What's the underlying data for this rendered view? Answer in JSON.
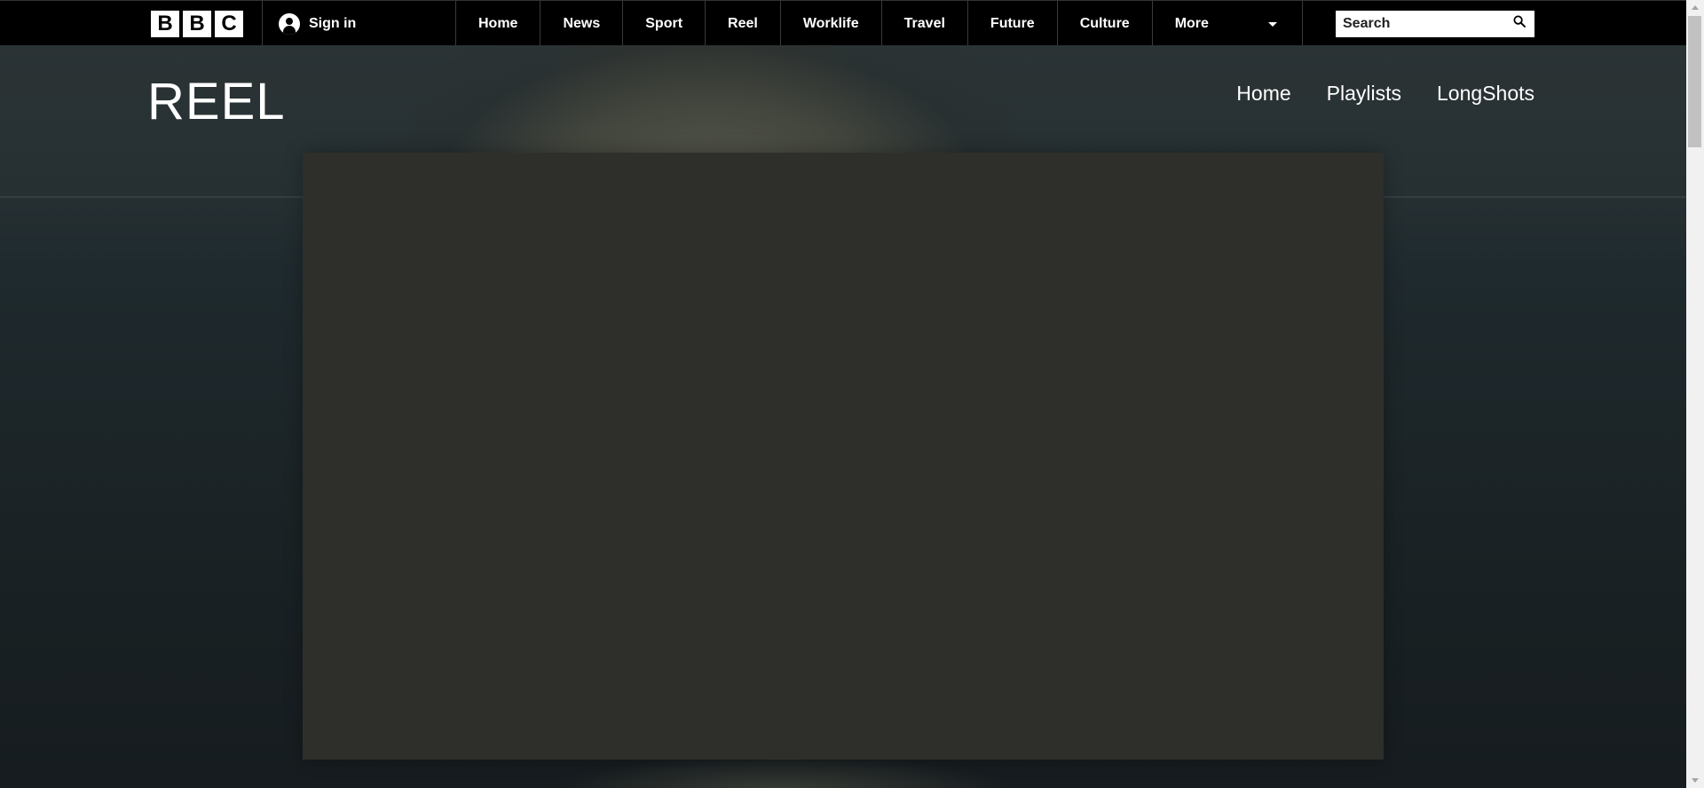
{
  "header": {
    "logo_letters": [
      "B",
      "B",
      "C"
    ],
    "signin_label": "Sign in",
    "nav": [
      "Home",
      "News",
      "Sport",
      "Reel",
      "Worklife",
      "Travel",
      "Future",
      "Culture",
      "More"
    ],
    "search": {
      "placeholder": "Search",
      "value": ""
    }
  },
  "reel": {
    "title": "REEL",
    "nav": [
      "Home",
      "Playlists",
      "LongShots"
    ]
  },
  "icons": {
    "user": "user-icon",
    "search": "search-icon",
    "more": "chevron-down-icon"
  },
  "colors": {
    "topbar": "#000000",
    "video_placeholder": "#2e2f2a",
    "text": "#ffffff"
  }
}
